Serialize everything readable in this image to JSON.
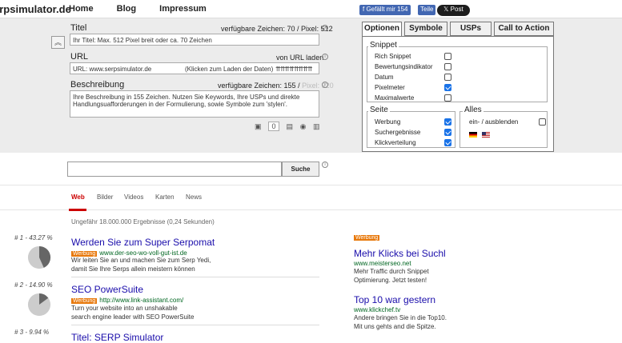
{
  "topbar": {
    "logo": "erpsimulator.de",
    "nav": [
      "Home",
      "Blog",
      "Impressum"
    ],
    "fb_like": "Gefällt mir 154",
    "fb_share": "Teile",
    "tweet": "Post"
  },
  "editor": {
    "title_label": "Titel",
    "title_info": "verfügbare Zeichen: 70 / Pixel: 512",
    "title_value": "Ihr Titel: Max. 512 Pixel breit oder ca. 70 Zeichen",
    "url_label": "URL",
    "url_info": "von URL laden",
    "url_value": "URL: www.serpsimulator.de",
    "url_hint": "(Klicken zum Laden der Daten)",
    "url_arrows": "⇈⇈⇈⇈⇈⇈⇈⇈",
    "desc_label": "Beschreibung",
    "desc_info_a": "verfügbare Zeichen: 155 /",
    "desc_info_b": "Pixel: 920",
    "desc_value": "Ihre Beschreibung in 155 Zeichen. Nutzen Sie Keywords, Ihre USPs und direkte Handlungsuafforderungen in der Formulierung, sowie Symbole zum 'stylen'.",
    "counter": "0"
  },
  "panel": {
    "tabs": [
      "Optionen",
      "Symbole",
      "USPs",
      "Call to Action"
    ],
    "snippet_title": "Snippet",
    "snippet_options": [
      {
        "label": "Rich Snippet",
        "checked": false
      },
      {
        "label": "Bewertungsindikator",
        "checked": false
      },
      {
        "label": "Datum",
        "checked": false
      },
      {
        "label": "Pixelmeter",
        "checked": true
      },
      {
        "label": "Maximalwerte",
        "checked": false
      }
    ],
    "seite_title": "Seite",
    "seite_options": [
      {
        "label": "Werbung",
        "checked": true
      },
      {
        "label": "Suchergebnisse",
        "checked": true
      },
      {
        "label": "Klickverteilung",
        "checked": true
      }
    ],
    "alles_title": "Alles",
    "alles_option": {
      "label": "ein- / ausblenden",
      "checked": false
    }
  },
  "search": {
    "button": "Suche",
    "tabs": [
      "Web",
      "Bilder",
      "Videos",
      "Karten",
      "News"
    ],
    "stats": "Ungefähr 18.000.000 Ergebnisse (0,24 Sekunden)"
  },
  "results": [
    {
      "rank": "# 1 - 43.27 %",
      "share": 0.4327,
      "title": "Werden Sie zum Super Serpomat",
      "badge": "Werbung",
      "url": "www.der-seo-wo-voll-gut-ist.de",
      "desc1": "Wir leiten Sie an und machen Sie zum Serp Yedi,",
      "desc2": "damit Sie Ihre Serps allein meistern können"
    },
    {
      "rank": "# 2 - 14.90 %",
      "share": 0.149,
      "title": "SEO PowerSuite",
      "badge": "Werbung",
      "url": "http://www.link-assistant.com/",
      "desc1": "Turn your website into an unshakable",
      "desc2": "search engine leader with SEO PowerSuite"
    },
    {
      "rank": "# 3 - 9.94 %",
      "share": 0.0994,
      "title": "Titel: SERP Simulator",
      "badge": "",
      "url": "",
      "desc1": "",
      "desc2": ""
    }
  ],
  "ads": {
    "badge": "Werbung",
    "items": [
      {
        "title": "Mehr Klicks bei Suchl",
        "url": "www.meisterseo.net",
        "desc1": "Mehr Traffic durch Snippet",
        "desc2": "Optimierung. Jetzt testen!"
      },
      {
        "title": "Top 10 war gestern",
        "url": "www.klickchef.tv",
        "desc1": "Andere bringen Sie in die Top10.",
        "desc2": "Mit uns gehts and die Spitze."
      }
    ]
  },
  "colors": {
    "accent": "#1a73e8",
    "link": "#1a0dab",
    "url": "#006621",
    "ad": "#e8790c",
    "active_tab": "#cc0000"
  }
}
